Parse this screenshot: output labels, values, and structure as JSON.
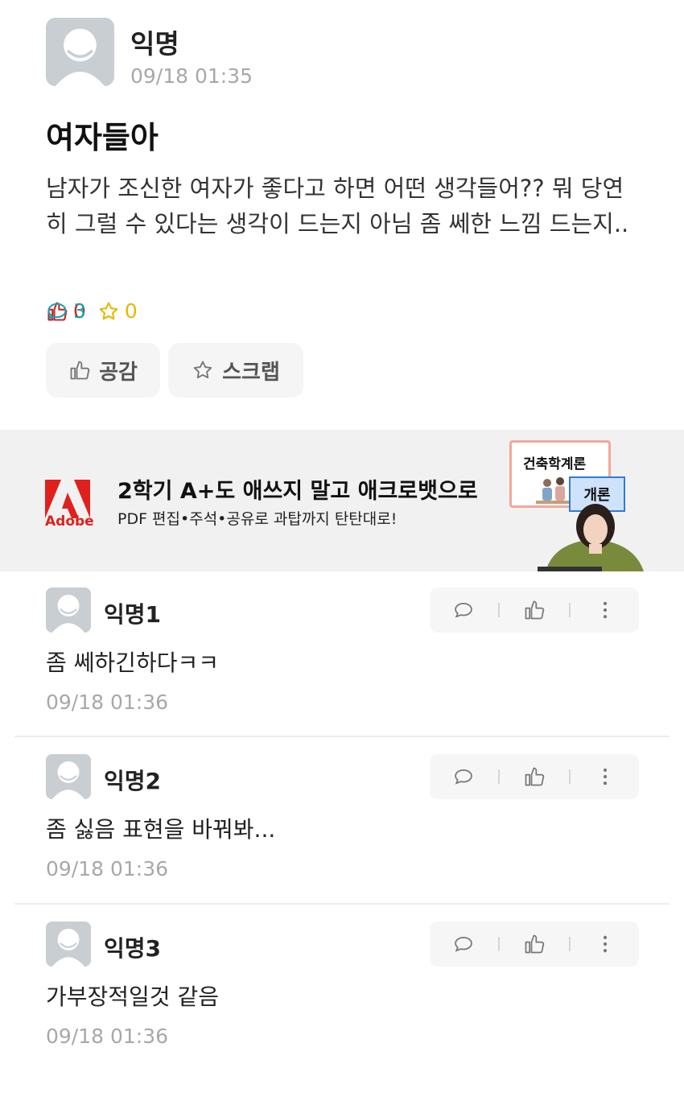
{
  "post": {
    "author": "익명",
    "time": "09/18 01:35",
    "title": "여자들아",
    "body": "남자가 조신한 여자가 좋다고 하면 어떤 생각들어?? 뭐 당연히 그럴 수 있다는 생각이 드는지 아님 좀 쎄한 느낌 드는지..",
    "likes": "0",
    "comments": "3",
    "scraps": "0",
    "like_button": "공감",
    "scrap_button": "스크랩",
    "colors": {
      "like": "#c62828",
      "comment": "#1aa3b3",
      "scrap": "#e8b800"
    }
  },
  "ad": {
    "brand": "Adobe",
    "headline": "2학기 A+도 애쓰지 말고 애크로뱃으로",
    "subline": "PDF 편집•주석•공유로 과탑까지 탄탄대로!",
    "card_text": "건축학계론",
    "chip_text": "개론",
    "brand_color": "#e0201d"
  },
  "comments": [
    {
      "author": "익명1",
      "text": "좀 쎄하긴하다ㅋㅋ",
      "time": "09/18 01:36"
    },
    {
      "author": "익명2",
      "text": "좀 싫음 표현을 바꿔봐...",
      "time": "09/18 01:36"
    },
    {
      "author": "익명3",
      "text": "가부장적일것 같음",
      "time": "09/18 01:36"
    }
  ]
}
